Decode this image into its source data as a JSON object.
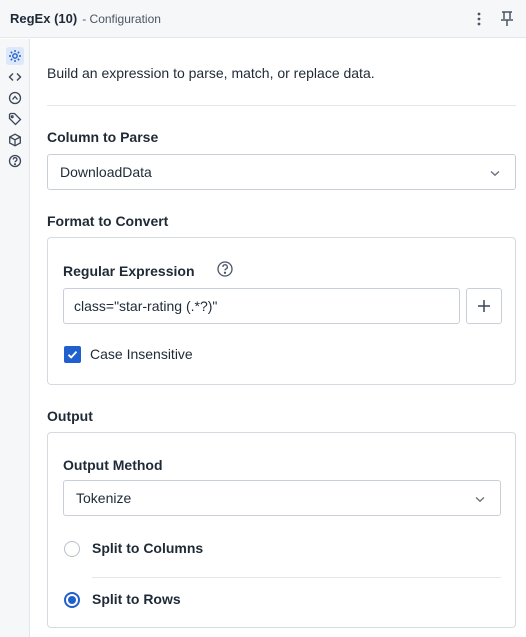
{
  "header": {
    "title": "RegEx (10)",
    "subtitle": "- Configuration",
    "menu_icon": "kebab-menu-icon",
    "pin_icon": "pin-icon"
  },
  "rail": {
    "items": [
      {
        "icon": "gear-icon",
        "active": true
      },
      {
        "icon": "code-icon",
        "active": false
      },
      {
        "icon": "annotation-icon",
        "active": false
      },
      {
        "icon": "tag-icon",
        "active": false
      },
      {
        "icon": "cube-icon",
        "active": false
      },
      {
        "icon": "help-icon",
        "active": false
      }
    ]
  },
  "intro": "Build an expression to parse, match, or replace data.",
  "column_to_parse": {
    "label": "Column to Parse",
    "value": "DownloadData"
  },
  "format_to_convert": {
    "label": "Format to Convert",
    "regex_label": "Regular Expression",
    "regex_value": "class=\"star-rating (.*?)\"",
    "case_insensitive_label": "Case Insensitive",
    "case_insensitive_checked": true
  },
  "output": {
    "label": "Output",
    "method_label": "Output Method",
    "method_value": "Tokenize",
    "options": [
      {
        "label": "Split to Columns",
        "selected": false
      },
      {
        "label": "Split to Rows",
        "selected": true
      }
    ]
  },
  "colors": {
    "accent": "#1f5fce",
    "border": "#c9cfd6",
    "header_bg": "#f6f7f9"
  }
}
